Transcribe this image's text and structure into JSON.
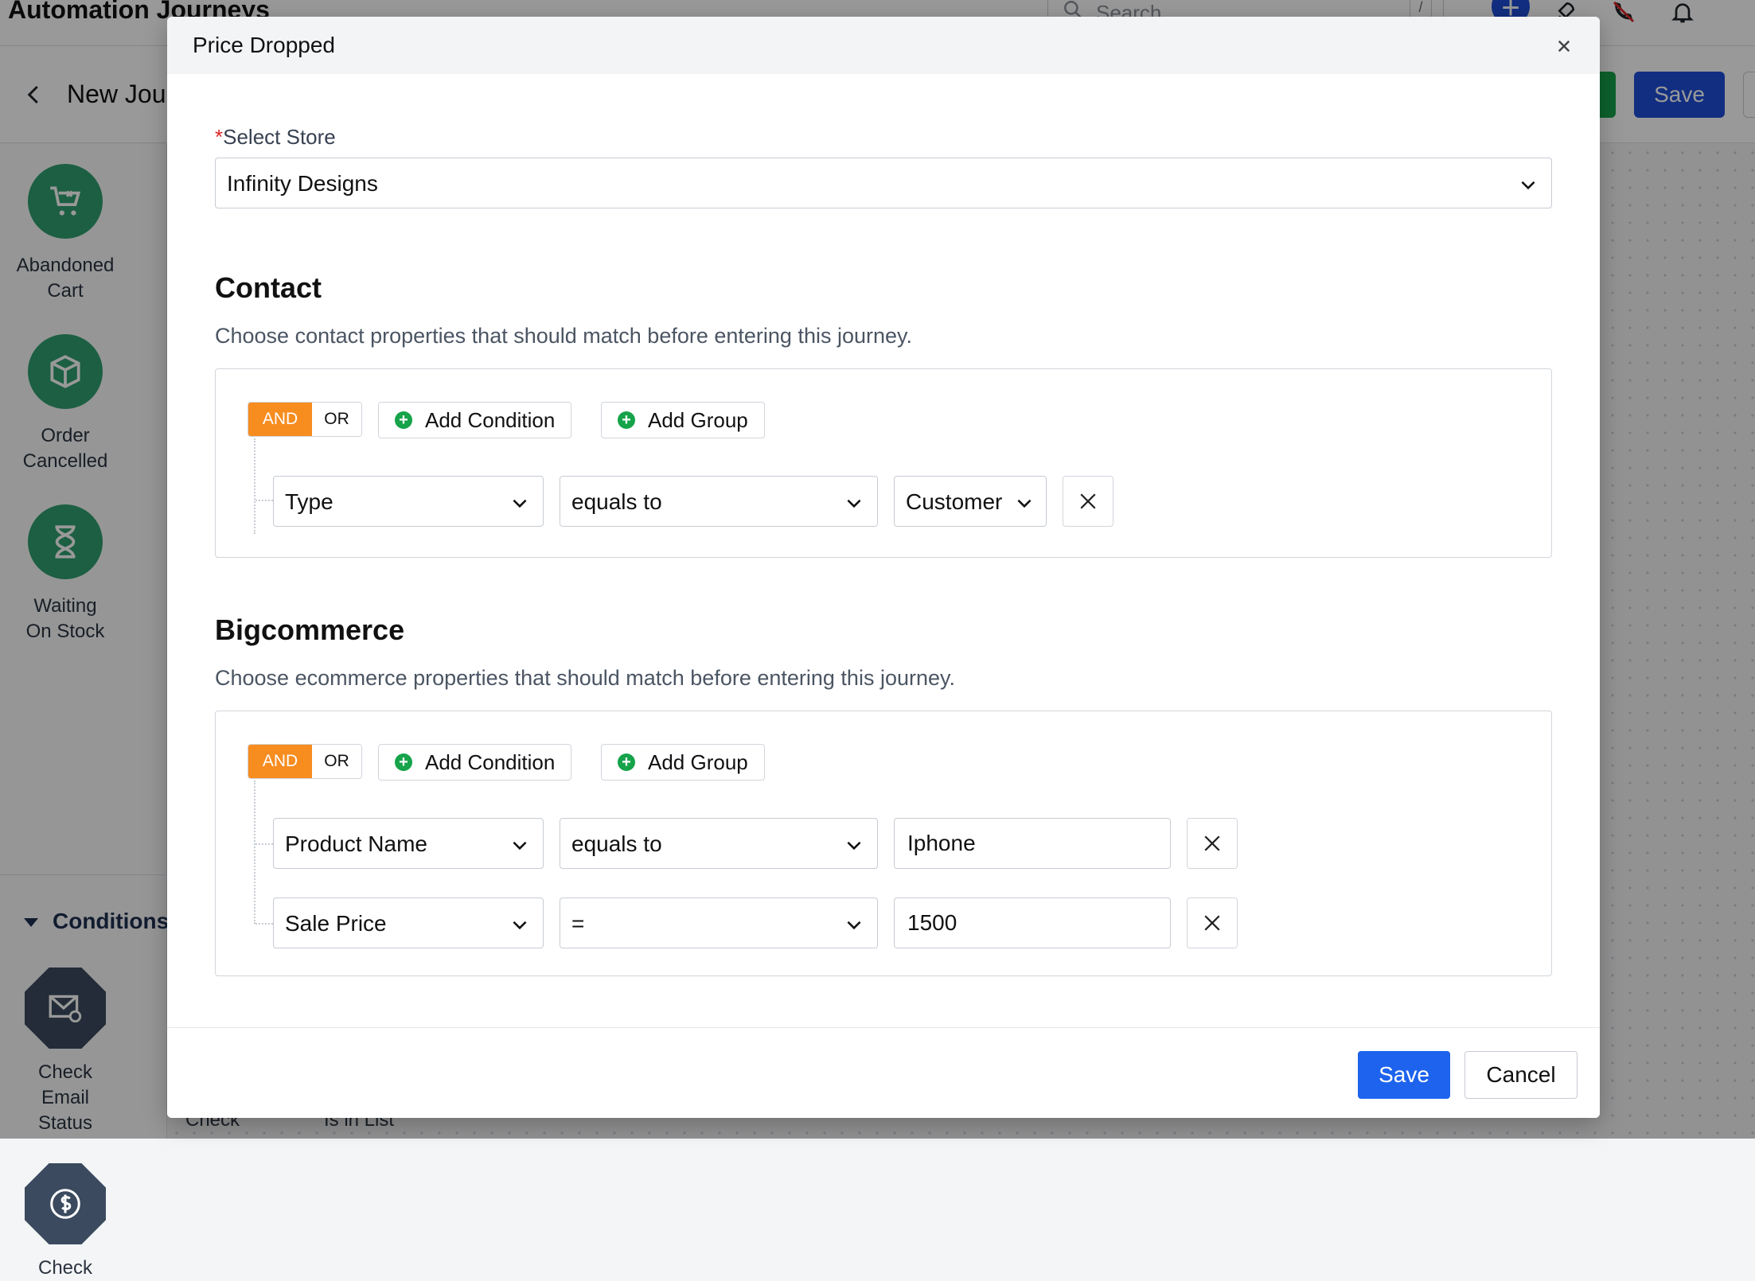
{
  "app": {
    "title": "Automation Journeys",
    "search_placeholder": "Search",
    "search_shortcut": "/",
    "plus_label": "+",
    "journey_name": "New Jou",
    "save_label": "Save"
  },
  "sidebar": {
    "triggers": [
      {
        "label_line1": "Abandoned",
        "label_line2": "Cart",
        "icon": "cart-icon"
      },
      {
        "label_line1": "Order",
        "label_line2": "Cancelled",
        "icon": "box-icon"
      },
      {
        "label_line1": "Waiting",
        "label_line2": "On Stock",
        "icon": "hourglass-icon"
      }
    ],
    "conditions_title": "Conditions",
    "conditions": [
      {
        "label_line1": "Check",
        "label_line2": "Email",
        "label_line3": "Status",
        "icon": "envelope-icon"
      },
      {
        "label_line1": "Check",
        "icon": "dollar-icon"
      }
    ],
    "bottom_labels": [
      "Check",
      "Is in List"
    ]
  },
  "modal": {
    "title": "Price Dropped",
    "store_label_required": "*",
    "store_label": "Select Store",
    "store_value": "Infinity Designs",
    "contact": {
      "title": "Contact",
      "description": "Choose contact properties that should match before entering this journey.",
      "and_label": "AND",
      "or_label": "OR",
      "add_condition_label": "Add Condition",
      "add_group_label": "Add Group",
      "rows": [
        {
          "field": "Type",
          "operator": "equals to",
          "value": "Customer"
        }
      ]
    },
    "bigcommerce": {
      "title": "Bigcommerce",
      "description": "Choose ecommerce properties that should match before entering this journey.",
      "and_label": "AND",
      "or_label": "OR",
      "add_condition_label": "Add Condition",
      "add_group_label": "Add Group",
      "rows": [
        {
          "field": "Product Name",
          "operator": "equals to",
          "value": "Iphone"
        },
        {
          "field": "Sale Price",
          "operator": "=",
          "value": "1500"
        }
      ]
    },
    "footer": {
      "save_label": "Save",
      "cancel_label": "Cancel"
    }
  },
  "colors": {
    "primary": "#1d63ed",
    "and_active": "#f78c1f",
    "add_icon": "#16a34a",
    "trigger_green": "#2f9e6e",
    "condition_slate": "#3b4a5e",
    "required": "#dc2626"
  }
}
